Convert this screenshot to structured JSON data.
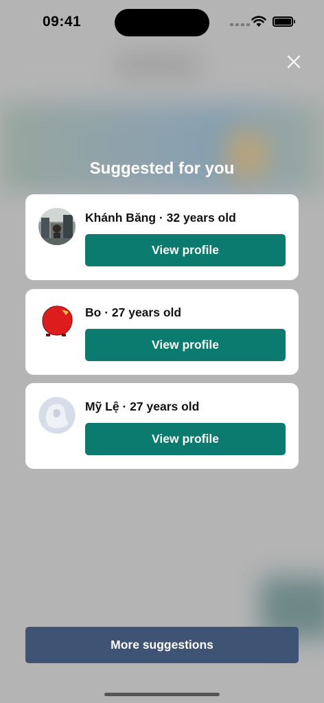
{
  "status_bar": {
    "time": "09:41"
  },
  "modal": {
    "title": "Suggested for you",
    "close_icon": "close-icon",
    "suggestions": [
      {
        "name": "Khánh Băng",
        "age_text": "32 years old",
        "button_label": "View profile",
        "avatar": "photo-avatar"
      },
      {
        "name": "Bo",
        "age_text": "27 years old",
        "button_label": "View profile",
        "avatar": "red-blob-avatar"
      },
      {
        "name": "Mỹ Lệ",
        "age_text": "27 years old",
        "button_label": "View profile",
        "avatar": "pale-avatar"
      }
    ],
    "more_button_label": "More suggestions"
  },
  "colors": {
    "view_button": "#0b7a6f",
    "more_button": "#3f5474",
    "overlay": "#b4b4b4"
  }
}
